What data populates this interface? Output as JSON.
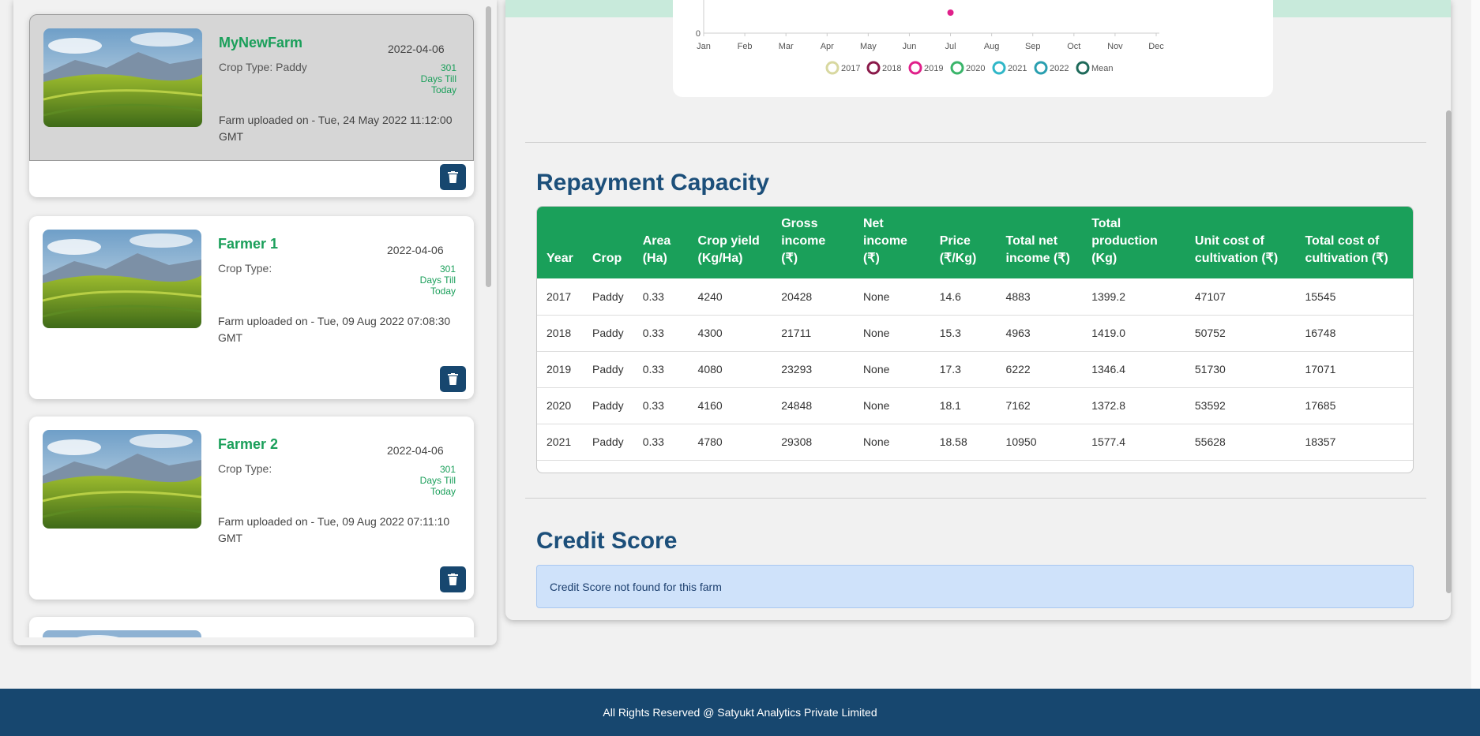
{
  "farms": [
    {
      "name": "MyNewFarm",
      "date": "2022-04-06",
      "crop_type": "Crop Type: Paddy",
      "days_num": "301",
      "days_line1": "Days Till",
      "days_line2": "Today",
      "uploaded": "Farm uploaded on - Tue, 24 May 2022 11:12:00 GMT",
      "selected": true
    },
    {
      "name": "Farmer 1",
      "date": "2022-04-06",
      "crop_type": "Crop Type:",
      "days_num": "301",
      "days_line1": "Days Till",
      "days_line2": "Today",
      "uploaded": "Farm uploaded on - Tue, 09 Aug 2022 07:08:30 GMT",
      "selected": false
    },
    {
      "name": "Farmer 2",
      "date": "2022-04-06",
      "crop_type": "Crop Type:",
      "days_num": "301",
      "days_line1": "Days Till",
      "days_line2": "Today",
      "uploaded": "Farm uploaded on - Tue, 09 Aug 2022 07:11:10 GMT",
      "selected": false
    }
  ],
  "chart_data": {
    "type": "line",
    "ytick_visible": "0",
    "x": [
      "Jan",
      "Feb",
      "Mar",
      "Apr",
      "May",
      "Jun",
      "Jul",
      "Aug",
      "Sep",
      "Oct",
      "Nov",
      "Dec"
    ],
    "series": [
      {
        "name": "2017",
        "color": "#d8d8a0"
      },
      {
        "name": "2018",
        "color": "#8a1a4a"
      },
      {
        "name": "2019",
        "color": "#e0208a"
      },
      {
        "name": "2020",
        "color": "#3ab56a"
      },
      {
        "name": "2021",
        "color": "#30b7c8"
      },
      {
        "name": "2022",
        "color": "#2a9fb0"
      },
      {
        "name": "Mean",
        "color": "#1e6a5a"
      }
    ],
    "legend_position": "bottom"
  },
  "repayment": {
    "title": "Repayment Capacity",
    "headers": [
      "Year",
      "Crop",
      "Area (Ha)",
      "Crop yield (Kg/Ha)",
      "Gross income (₹)",
      "Net income (₹)",
      "Price (₹/Kg)",
      "Total net income (₹)",
      "Total production (Kg)",
      "Unit cost of cultivation (₹)",
      "Total cost of cultivation (₹)"
    ],
    "rows": [
      [
        "2017",
        "Paddy",
        "0.33",
        "4240",
        "20428",
        "None",
        "14.6",
        "4883",
        "1399.2",
        "47107",
        "15545"
      ],
      [
        "2018",
        "Paddy",
        "0.33",
        "4300",
        "21711",
        "None",
        "15.3",
        "4963",
        "1419.0",
        "50752",
        "16748"
      ],
      [
        "2019",
        "Paddy",
        "0.33",
        "4080",
        "23293",
        "None",
        "17.3",
        "6222",
        "1346.4",
        "51730",
        "17071"
      ],
      [
        "2020",
        "Paddy",
        "0.33",
        "4160",
        "24848",
        "None",
        "18.1",
        "7162",
        "1372.8",
        "53592",
        "17685"
      ],
      [
        "2021",
        "Paddy",
        "0.33",
        "4780",
        "29308",
        "None",
        "18.58",
        "10950",
        "1577.4",
        "55628",
        "18357"
      ]
    ]
  },
  "credit": {
    "title": "Credit Score",
    "message": "Credit Score not found for this farm"
  },
  "footer": {
    "text": "All Rights Reserved @ Satyukt Analytics Private Limited"
  },
  "colors": {
    "accent_green": "#1aa05a",
    "navy": "#17476f",
    "title_blue": "#1c4f7a"
  }
}
